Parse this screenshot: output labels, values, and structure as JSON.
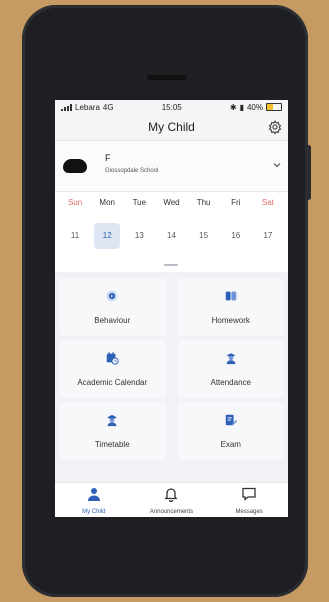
{
  "status_bar": {
    "carrier": "Lebara",
    "network": "4G",
    "time": "15:05",
    "battery": "40%",
    "battery_level": 0.4
  },
  "header": {
    "title": "My Child"
  },
  "child": {
    "name": "F",
    "school": "Glossopdale School"
  },
  "calendar": {
    "days": [
      "Sun",
      "Mon",
      "Tue",
      "Wed",
      "Thu",
      "Fri",
      "Sat"
    ],
    "dates": [
      "11",
      "12",
      "13",
      "14",
      "15",
      "16",
      "17"
    ],
    "selected_index": 1
  },
  "tiles": [
    {
      "label": "Behaviour",
      "icon": "behaviour-icon"
    },
    {
      "label": "Homework",
      "icon": "homework-book-icon"
    },
    {
      "label": "Academic Calendar",
      "icon": "calendar-clock-icon"
    },
    {
      "label": "Attendance",
      "icon": "attendance-person-icon"
    },
    {
      "label": "Timetable",
      "icon": "timetable-graduate-icon"
    },
    {
      "label": "Exam",
      "icon": "exam-pencil-icon"
    }
  ],
  "tabs": [
    {
      "label": "My Child",
      "icon": "person-icon",
      "active": true
    },
    {
      "label": "Announcements",
      "icon": "bell-icon",
      "active": false
    },
    {
      "label": "Messages",
      "icon": "chat-bubble-icon",
      "active": false
    }
  ],
  "colors": {
    "accent": "#2f62b6",
    "weekend": "#e06a6a",
    "battery": "#f2c230"
  }
}
